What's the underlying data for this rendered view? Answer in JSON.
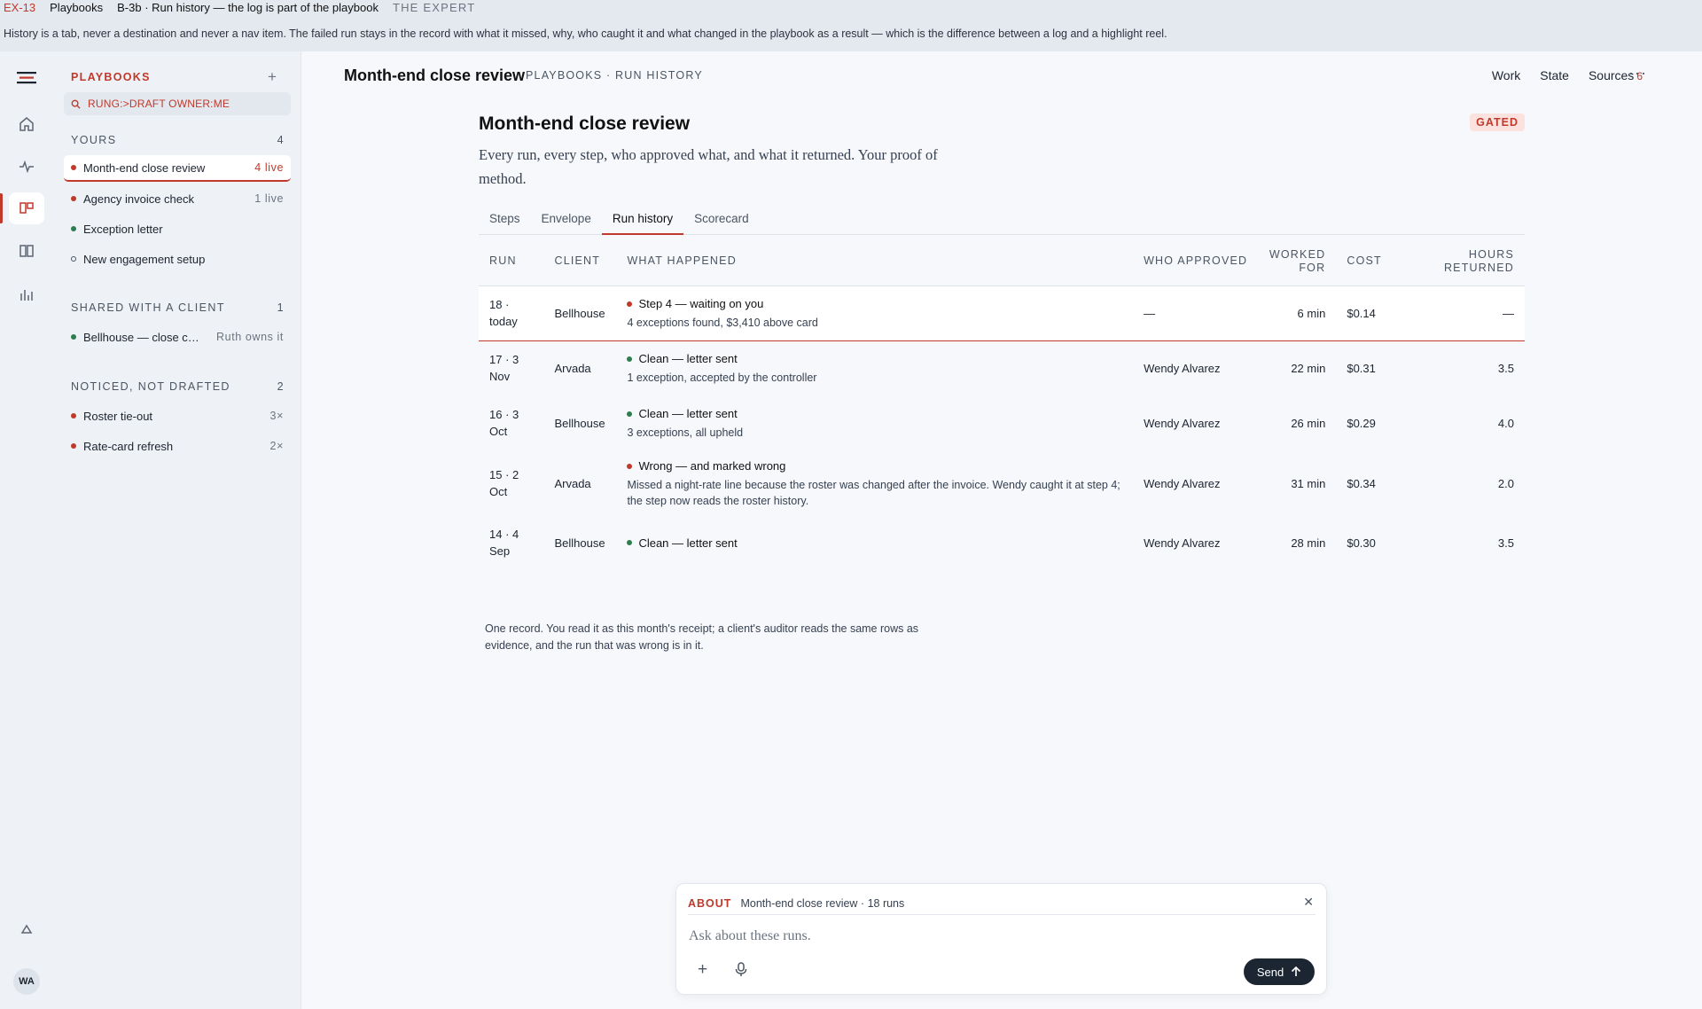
{
  "banner": {
    "code": "EX-13",
    "section": "Playbooks",
    "page": "B-3b · Run history — the log is part of the playbook",
    "role": "THE EXPERT",
    "note": "History is a tab, never a destination and never a nav item. The failed run stays in the record with what it missed, why, who caught it and what changed in the playbook as a result — which is the difference between a log and a highlight reel."
  },
  "rail": {
    "icons": [
      "logo-icon",
      "home-icon",
      "pulse-icon",
      "playbooks-icon",
      "book-icon",
      "chart-icon",
      "collapse-icon"
    ],
    "avatar": "WA"
  },
  "sidebar": {
    "title": "PLAYBOOKS",
    "search": "RUNG:>DRAFT OWNER:ME",
    "groups": [
      {
        "label": "YOURS",
        "count": "4",
        "items": [
          {
            "label": "Month-end close review",
            "meta": "4 live",
            "dot": "red"
          },
          {
            "label": "Agency invoice check",
            "meta": "1 live",
            "dot": "red"
          },
          {
            "label": "Exception letter",
            "meta": "",
            "dot": "green"
          },
          {
            "label": "New engagement setup",
            "meta": "",
            "dot": "hollow"
          }
        ]
      },
      {
        "label": "SHARED WITH A CLIENT",
        "count": "1",
        "items": [
          {
            "label": "Bellhouse — close checklist",
            "meta": "Ruth owns it",
            "dot": "green"
          }
        ]
      },
      {
        "label": "NOTICED, NOT DRAFTED",
        "count": "2",
        "items": [
          {
            "label": "Roster tie-out",
            "meta": "3×",
            "dot": "red"
          },
          {
            "label": "Rate-card refresh",
            "meta": "2×",
            "dot": "red"
          }
        ]
      }
    ]
  },
  "topbar": {
    "title": "Month-end close review",
    "crumb": "PLAYBOOKS · RUN HISTORY",
    "links": [
      "Work",
      "State",
      "Sources"
    ],
    "sources_count": "6"
  },
  "pane": {
    "title": "Month-end close review",
    "badge": "GATED",
    "subtitle": "Every run, every step, who approved what, and what it returned. Your proof of method.",
    "tabs": [
      "Steps",
      "Envelope",
      "Run history",
      "Scorecard"
    ],
    "active_tab": 2
  },
  "table": {
    "headers": {
      "run": "RUN",
      "client": "CLIENT",
      "what": "WHAT HAPPENED",
      "who": "WHO APPROVED",
      "worked": "WORKED FOR",
      "cost": "COST",
      "hours": "HOURS RETURNED"
    },
    "rows": [
      {
        "run": "18 · today",
        "client": "Bellhouse",
        "status": "Step 4 — waiting on you",
        "detail": "4 exceptions found, $3,410 above card",
        "dot": "red",
        "who": "—",
        "worked": "6 min",
        "cost": "$0.14",
        "hours": "—",
        "current": true
      },
      {
        "run": "17 · 3 Nov",
        "client": "Arvada",
        "status": "Clean — letter sent",
        "detail": "1 exception, accepted by the controller",
        "dot": "green",
        "who": "Wendy Alvarez",
        "worked": "22 min",
        "cost": "$0.31",
        "hours": "3.5",
        "current": false
      },
      {
        "run": "16 · 3 Oct",
        "client": "Bellhouse",
        "status": "Clean — letter sent",
        "detail": "3 exceptions, all upheld",
        "dot": "green",
        "who": "Wendy Alvarez",
        "worked": "26 min",
        "cost": "$0.29",
        "hours": "4.0",
        "current": false
      },
      {
        "run": "15 · 2 Oct",
        "client": "Arvada",
        "status": "Wrong — and marked wrong",
        "detail": "Missed a night-rate line because the roster was changed after the invoice. Wendy caught it at step 4; the step now reads the roster history.",
        "dot": "red",
        "who": "Wendy Alvarez",
        "worked": "31 min",
        "cost": "$0.34",
        "hours": "2.0",
        "current": false
      },
      {
        "run": "14 · 4 Sep",
        "client": "Bellhouse",
        "status": "Clean — letter sent",
        "detail": "",
        "dot": "green",
        "who": "Wendy Alvarez",
        "worked": "28 min",
        "cost": "$0.30",
        "hours": "3.5",
        "current": false
      }
    ],
    "footnote": "One record. You read it as this month's receipt; a client's auditor reads the same rows as evidence, and the run that was wrong is in it."
  },
  "composer": {
    "about": "ABOUT",
    "context": "Month-end close review · 18 runs",
    "placeholder": "Ask about these runs.",
    "send": "Send"
  },
  "colors": {
    "accent": "#c0392b",
    "ok": "#2e7d4f",
    "ink": "#1c2430"
  }
}
